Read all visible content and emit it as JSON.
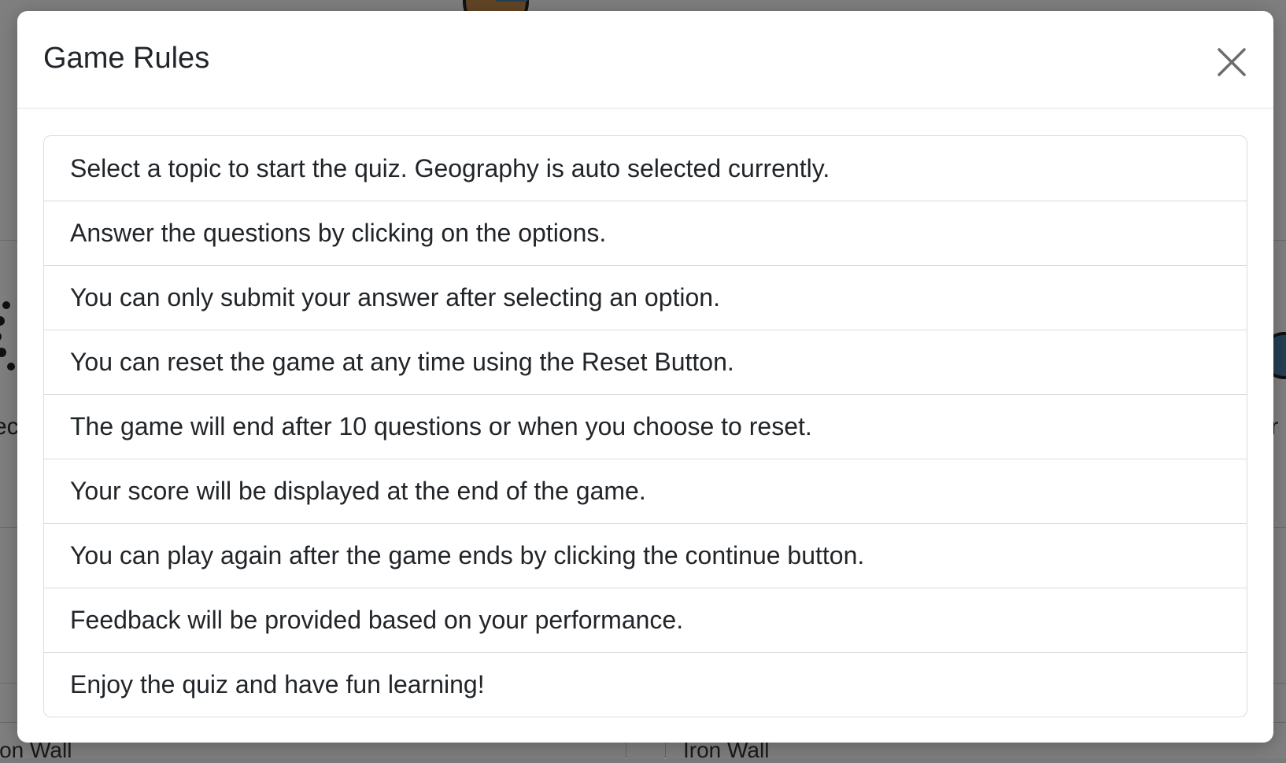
{
  "modal": {
    "title": "Game Rules",
    "close_icon": "close-icon",
    "rules": [
      "Select a topic to start the quiz. Geography is auto selected currently.",
      "Answer the questions by clicking on the options.",
      "You can only submit your answer after selecting an option.",
      "You can reset the game at any time using the Reset Button.",
      "The game will end after 10 questions or when you choose to reset.",
      "Your score will be displayed at the end of the game.",
      "You can play again after the game ends by clicking the continue button.",
      "Feedback will be provided based on your performance.",
      "Enjoy the quiz and have fun learning!"
    ]
  },
  "background": {
    "cards": [
      "Iron Wall",
      "Iron Wall"
    ]
  },
  "colors": {
    "backdrop": "#000000",
    "modal_bg": "#ffffff",
    "text": "#212529",
    "border": "#dcdcdc"
  }
}
